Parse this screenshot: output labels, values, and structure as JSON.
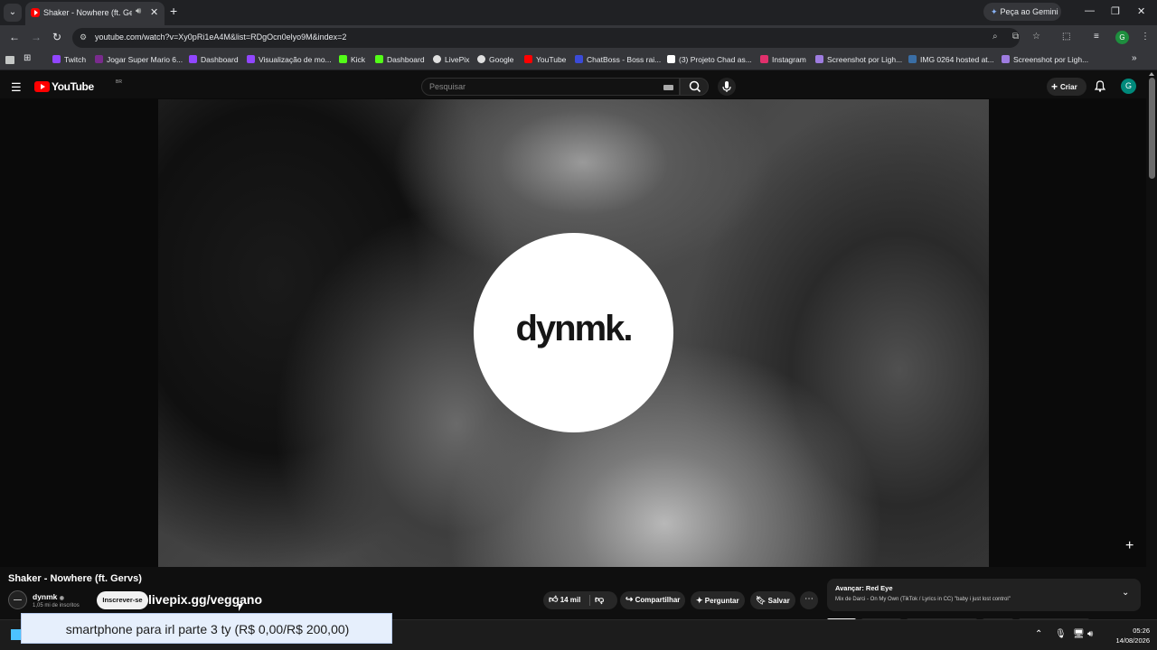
{
  "browser": {
    "tab": {
      "title": "Shaker - Nowhere (ft. Gervs)"
    },
    "gemini_label": "Peça ao Gemini",
    "url": "youtube.com/watch?v=Xy0pRi1eA4M&list=RDgOcn0elyo9M&index=2",
    "profile_initial": "G",
    "bookmarks": [
      {
        "label": "Twitch",
        "color": "#9146ff"
      },
      {
        "label": "Jogar Super Mario 6...",
        "color": "#7a2b8e"
      },
      {
        "label": "Dashboard",
        "color": "#9146ff"
      },
      {
        "label": "Visualização de mo...",
        "color": "#9146ff"
      },
      {
        "label": "Kick",
        "color": "#53fc18"
      },
      {
        "label": "Dashboard",
        "color": "#53fc18"
      },
      {
        "label": "LivePix",
        "color": "#e0e0e0"
      },
      {
        "label": "Google",
        "color": "#e0e0e0"
      },
      {
        "label": "YouTube",
        "color": "#ff0000"
      },
      {
        "label": "ChatBoss - Boss rai...",
        "color": "#3b4bd8"
      },
      {
        "label": "(3) Projeto Chad as...",
        "color": "#ffffff"
      },
      {
        "label": "Instagram",
        "color": "#e1306c"
      },
      {
        "label": "Screenshot por Ligh...",
        "color": "#9e7ce0"
      },
      {
        "label": "IMG 0264 hosted at...",
        "color": "#3a6ea5"
      },
      {
        "label": "Screenshot por Ligh...",
        "color": "#9e7ce0"
      }
    ]
  },
  "youtube": {
    "search_placeholder": "Pesquisar",
    "create_label": "Criar",
    "avatar_initial": "G",
    "video_logo_text": "dynmk.",
    "video_title": "Shaker - Nowhere (ft. Gervs)",
    "channel": {
      "name": "dynmk",
      "subscribers": "1,05 mi de inscritos"
    },
    "subscribe_label": "Inscrever-se",
    "overlay_link": "livepix.gg/veggano",
    "actions": {
      "likes": "14 mil",
      "share": "Compartilhar",
      "ask": "Perguntar",
      "save": "Salvar"
    },
    "up_next": {
      "label": "Avançar: Red Eye",
      "subtitle": "Mix de Darci - On My Own (TikTok / Lyrics in CC) \"baby i just lost control\""
    }
  },
  "donation_text": "smartphone para irl parte 3 ty (R$ 0,00/R$ 200,00)",
  "taskbar": {
    "time": "05:26",
    "date": "14/08/2026"
  },
  "colors": {
    "youtube_red": "#ff0000",
    "background": "#0f0f0f",
    "chrome_dark": "#202124"
  }
}
